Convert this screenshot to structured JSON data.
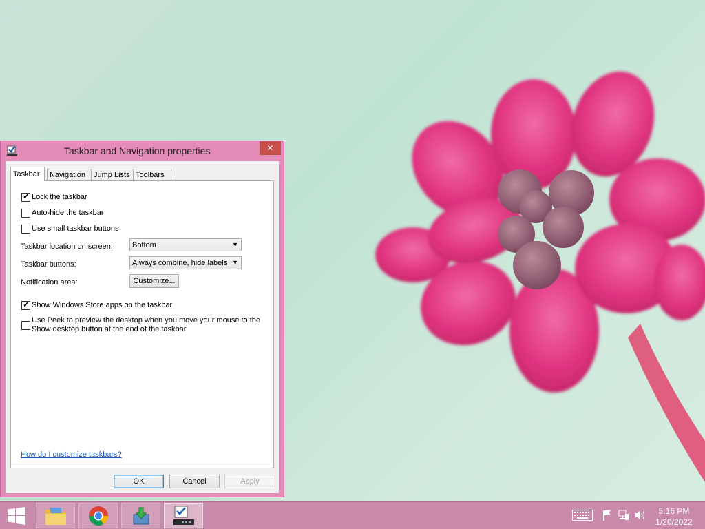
{
  "dialog": {
    "title": "Taskbar and Navigation properties",
    "close_label": "✕",
    "tabs": [
      {
        "label": "Taskbar",
        "active": true
      },
      {
        "label": "Navigation",
        "active": false
      },
      {
        "label": "Jump Lists",
        "active": false
      },
      {
        "label": "Toolbars",
        "active": false
      }
    ],
    "options": {
      "lock_taskbar": {
        "label": "Lock the taskbar",
        "checked": true
      },
      "auto_hide": {
        "label": "Auto-hide the taskbar",
        "checked": false
      },
      "small_buttons": {
        "label": "Use small taskbar buttons",
        "checked": false
      },
      "location": {
        "label": "Taskbar location on screen:",
        "value": "Bottom"
      },
      "buttons": {
        "label": "Taskbar buttons:",
        "value": "Always combine, hide labels"
      },
      "notification": {
        "label": "Notification area:",
        "button": "Customize..."
      },
      "store_apps": {
        "label": "Show Windows Store apps on the taskbar",
        "checked": true
      },
      "peek": {
        "label_line1": "Use Peek to preview the desktop when you move your mouse to the",
        "label_line2": "Show desktop button at the end of the taskbar",
        "checked": false
      }
    },
    "help_link": "How do I customize taskbars?",
    "buttons": {
      "ok": "OK",
      "cancel": "Cancel",
      "apply": "Apply"
    }
  },
  "taskbar": {
    "items": [
      {
        "icon": "windows-start-icon"
      },
      {
        "icon": "file-explorer-icon"
      },
      {
        "icon": "chrome-icon"
      },
      {
        "icon": "download-installer-icon"
      },
      {
        "icon": "taskbar-properties-icon",
        "active": true
      }
    ],
    "tray": [
      "keyboard-icon",
      "action-center-flag-icon",
      "network-icon",
      "volume-icon"
    ],
    "time": "5:16 PM",
    "date": "1/20/2022"
  },
  "colors": {
    "accent": "#e48bb8",
    "taskbar": "#c889aa",
    "close": "#c7504a",
    "flower": "#e0337f"
  }
}
